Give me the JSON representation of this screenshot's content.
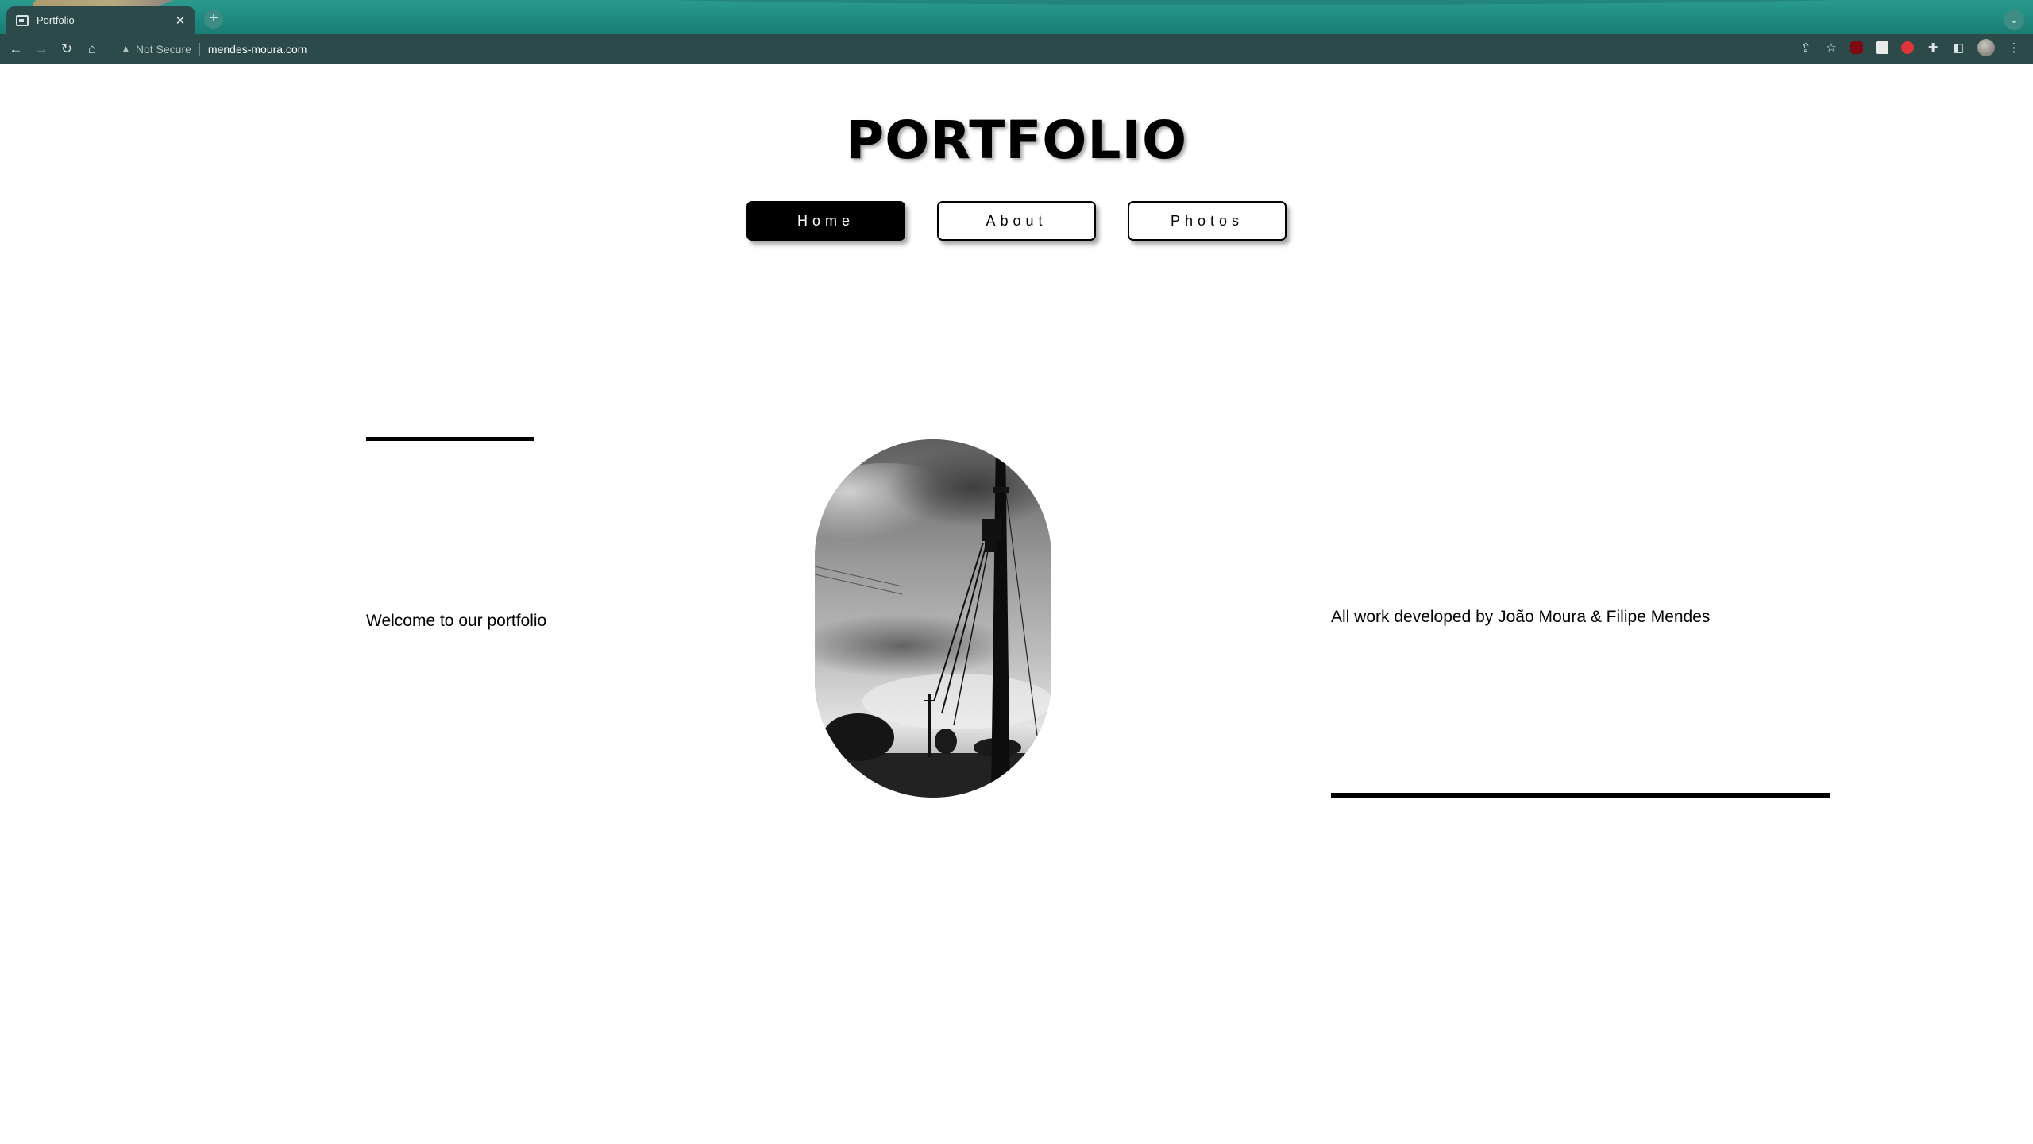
{
  "browser": {
    "tab_title": "Portfolio",
    "tab_close_icon": "close-icon",
    "new_tab_icon": "plus-icon",
    "security_label": "Not Secure",
    "url": "mendes-moura.com"
  },
  "site": {
    "title": "PORTFOLIO",
    "nav": [
      {
        "label": "Home",
        "active": true
      },
      {
        "label": "About",
        "active": false
      },
      {
        "label": "Photos",
        "active": false
      }
    ],
    "welcome_text": "Welcome to our portfolio",
    "credit_text": "All work developed by João Moura & Filipe Mendes"
  },
  "colors": {
    "tabstrip": "#2a9a8f",
    "toolbar": "#2c4a49",
    "accent": "#000000",
    "page_bg": "#ffffff"
  }
}
